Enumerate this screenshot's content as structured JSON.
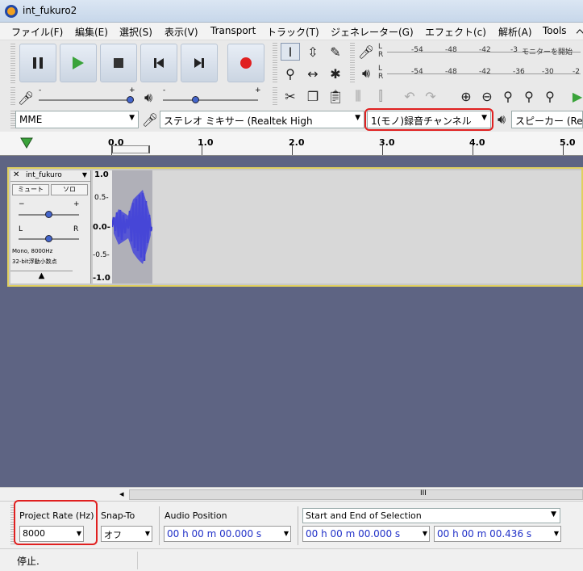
{
  "window": {
    "title": "int_fukuro2"
  },
  "menu": [
    "ファイル(F)",
    "編集(E)",
    "選択(S)",
    "表示(V)",
    "Transport",
    "トラック(T)",
    "ジェネレーター(G)",
    "エフェクト(c)",
    "解析(A)",
    "Tools",
    "ヘ"
  ],
  "meter": {
    "record_scale": [
      "-54",
      "-48",
      "-42",
      "-3",
      "モニターを開始"
    ],
    "play_scale": [
      "-54",
      "-48",
      "-42",
      "-36",
      "-30",
      "-2"
    ],
    "lr_labels": [
      "L",
      "R"
    ]
  },
  "sliders": {
    "plus_sign": "+",
    "minus_sign": "-"
  },
  "device": {
    "host": "MME",
    "input": "ステレオ ミキサー (Realtek High",
    "channels": "1(モノ)録音チャンネル",
    "output": "スピーカー (Re"
  },
  "ruler": {
    "labels": [
      "0.0",
      "1.0",
      "2.0",
      "3.0",
      "4.0",
      "5.0"
    ]
  },
  "track": {
    "name": "int_fukuro",
    "close": "✕",
    "mute": "ミュート",
    "solo": "ソロ",
    "gain_minus": "−",
    "gain_plus": "+",
    "pan_l": "L",
    "pan_r": "R",
    "info1": "Mono, 8000Hz",
    "info2": "32-bit浮動小数点",
    "collapse": "▲",
    "scale": [
      "1.0",
      "0.5-",
      "0.0-",
      "-0.5-",
      "-1.0"
    ]
  },
  "scrollbar": {
    "left_arrow": "◂",
    "grip": "III"
  },
  "selection_toolbar": {
    "project_rate_label": "Project Rate (Hz)",
    "project_rate_value": "8000",
    "snap_to_label": "Snap-To",
    "snap_to_value": "オフ",
    "audio_position_label": "Audio Position",
    "audio_position_value": "00 h 00 m 00.000 s",
    "selection_mode": "Start and End of Selection",
    "selection_start": "00 h 00 m 00.000 s",
    "selection_end": "00 h 00 m 00.436 s"
  },
  "status": {
    "text": "停止."
  },
  "colors": {
    "waveform": "#3f3fd0",
    "track_bg": "#5e6483",
    "highlight": "#e02020",
    "record": "#e02020",
    "play": "#3aa33a"
  }
}
